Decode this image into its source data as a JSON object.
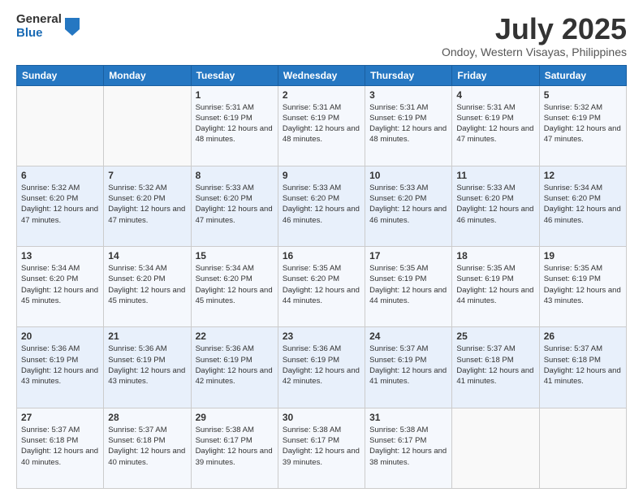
{
  "logo": {
    "general": "General",
    "blue": "Blue"
  },
  "title": "July 2025",
  "subtitle": "Ondoy, Western Visayas, Philippines",
  "weekdays": [
    "Sunday",
    "Monday",
    "Tuesday",
    "Wednesday",
    "Thursday",
    "Friday",
    "Saturday"
  ],
  "weeks": [
    [
      {
        "day": "",
        "sunrise": "",
        "sunset": "",
        "daylight": ""
      },
      {
        "day": "",
        "sunrise": "",
        "sunset": "",
        "daylight": ""
      },
      {
        "day": "1",
        "sunrise": "Sunrise: 5:31 AM",
        "sunset": "Sunset: 6:19 PM",
        "daylight": "Daylight: 12 hours and 48 minutes."
      },
      {
        "day": "2",
        "sunrise": "Sunrise: 5:31 AM",
        "sunset": "Sunset: 6:19 PM",
        "daylight": "Daylight: 12 hours and 48 minutes."
      },
      {
        "day": "3",
        "sunrise": "Sunrise: 5:31 AM",
        "sunset": "Sunset: 6:19 PM",
        "daylight": "Daylight: 12 hours and 48 minutes."
      },
      {
        "day": "4",
        "sunrise": "Sunrise: 5:31 AM",
        "sunset": "Sunset: 6:19 PM",
        "daylight": "Daylight: 12 hours and 47 minutes."
      },
      {
        "day": "5",
        "sunrise": "Sunrise: 5:32 AM",
        "sunset": "Sunset: 6:19 PM",
        "daylight": "Daylight: 12 hours and 47 minutes."
      }
    ],
    [
      {
        "day": "6",
        "sunrise": "Sunrise: 5:32 AM",
        "sunset": "Sunset: 6:20 PM",
        "daylight": "Daylight: 12 hours and 47 minutes."
      },
      {
        "day": "7",
        "sunrise": "Sunrise: 5:32 AM",
        "sunset": "Sunset: 6:20 PM",
        "daylight": "Daylight: 12 hours and 47 minutes."
      },
      {
        "day": "8",
        "sunrise": "Sunrise: 5:33 AM",
        "sunset": "Sunset: 6:20 PM",
        "daylight": "Daylight: 12 hours and 47 minutes."
      },
      {
        "day": "9",
        "sunrise": "Sunrise: 5:33 AM",
        "sunset": "Sunset: 6:20 PM",
        "daylight": "Daylight: 12 hours and 46 minutes."
      },
      {
        "day": "10",
        "sunrise": "Sunrise: 5:33 AM",
        "sunset": "Sunset: 6:20 PM",
        "daylight": "Daylight: 12 hours and 46 minutes."
      },
      {
        "day": "11",
        "sunrise": "Sunrise: 5:33 AM",
        "sunset": "Sunset: 6:20 PM",
        "daylight": "Daylight: 12 hours and 46 minutes."
      },
      {
        "day": "12",
        "sunrise": "Sunrise: 5:34 AM",
        "sunset": "Sunset: 6:20 PM",
        "daylight": "Daylight: 12 hours and 46 minutes."
      }
    ],
    [
      {
        "day": "13",
        "sunrise": "Sunrise: 5:34 AM",
        "sunset": "Sunset: 6:20 PM",
        "daylight": "Daylight: 12 hours and 45 minutes."
      },
      {
        "day": "14",
        "sunrise": "Sunrise: 5:34 AM",
        "sunset": "Sunset: 6:20 PM",
        "daylight": "Daylight: 12 hours and 45 minutes."
      },
      {
        "day": "15",
        "sunrise": "Sunrise: 5:34 AM",
        "sunset": "Sunset: 6:20 PM",
        "daylight": "Daylight: 12 hours and 45 minutes."
      },
      {
        "day": "16",
        "sunrise": "Sunrise: 5:35 AM",
        "sunset": "Sunset: 6:20 PM",
        "daylight": "Daylight: 12 hours and 44 minutes."
      },
      {
        "day": "17",
        "sunrise": "Sunrise: 5:35 AM",
        "sunset": "Sunset: 6:19 PM",
        "daylight": "Daylight: 12 hours and 44 minutes."
      },
      {
        "day": "18",
        "sunrise": "Sunrise: 5:35 AM",
        "sunset": "Sunset: 6:19 PM",
        "daylight": "Daylight: 12 hours and 44 minutes."
      },
      {
        "day": "19",
        "sunrise": "Sunrise: 5:35 AM",
        "sunset": "Sunset: 6:19 PM",
        "daylight": "Daylight: 12 hours and 43 minutes."
      }
    ],
    [
      {
        "day": "20",
        "sunrise": "Sunrise: 5:36 AM",
        "sunset": "Sunset: 6:19 PM",
        "daylight": "Daylight: 12 hours and 43 minutes."
      },
      {
        "day": "21",
        "sunrise": "Sunrise: 5:36 AM",
        "sunset": "Sunset: 6:19 PM",
        "daylight": "Daylight: 12 hours and 43 minutes."
      },
      {
        "day": "22",
        "sunrise": "Sunrise: 5:36 AM",
        "sunset": "Sunset: 6:19 PM",
        "daylight": "Daylight: 12 hours and 42 minutes."
      },
      {
        "day": "23",
        "sunrise": "Sunrise: 5:36 AM",
        "sunset": "Sunset: 6:19 PM",
        "daylight": "Daylight: 12 hours and 42 minutes."
      },
      {
        "day": "24",
        "sunrise": "Sunrise: 5:37 AM",
        "sunset": "Sunset: 6:19 PM",
        "daylight": "Daylight: 12 hours and 41 minutes."
      },
      {
        "day": "25",
        "sunrise": "Sunrise: 5:37 AM",
        "sunset": "Sunset: 6:18 PM",
        "daylight": "Daylight: 12 hours and 41 minutes."
      },
      {
        "day": "26",
        "sunrise": "Sunrise: 5:37 AM",
        "sunset": "Sunset: 6:18 PM",
        "daylight": "Daylight: 12 hours and 41 minutes."
      }
    ],
    [
      {
        "day": "27",
        "sunrise": "Sunrise: 5:37 AM",
        "sunset": "Sunset: 6:18 PM",
        "daylight": "Daylight: 12 hours and 40 minutes."
      },
      {
        "day": "28",
        "sunrise": "Sunrise: 5:37 AM",
        "sunset": "Sunset: 6:18 PM",
        "daylight": "Daylight: 12 hours and 40 minutes."
      },
      {
        "day": "29",
        "sunrise": "Sunrise: 5:38 AM",
        "sunset": "Sunset: 6:17 PM",
        "daylight": "Daylight: 12 hours and 39 minutes."
      },
      {
        "day": "30",
        "sunrise": "Sunrise: 5:38 AM",
        "sunset": "Sunset: 6:17 PM",
        "daylight": "Daylight: 12 hours and 39 minutes."
      },
      {
        "day": "31",
        "sunrise": "Sunrise: 5:38 AM",
        "sunset": "Sunset: 6:17 PM",
        "daylight": "Daylight: 12 hours and 38 minutes."
      },
      {
        "day": "",
        "sunrise": "",
        "sunset": "",
        "daylight": ""
      },
      {
        "day": "",
        "sunrise": "",
        "sunset": "",
        "daylight": ""
      }
    ]
  ]
}
